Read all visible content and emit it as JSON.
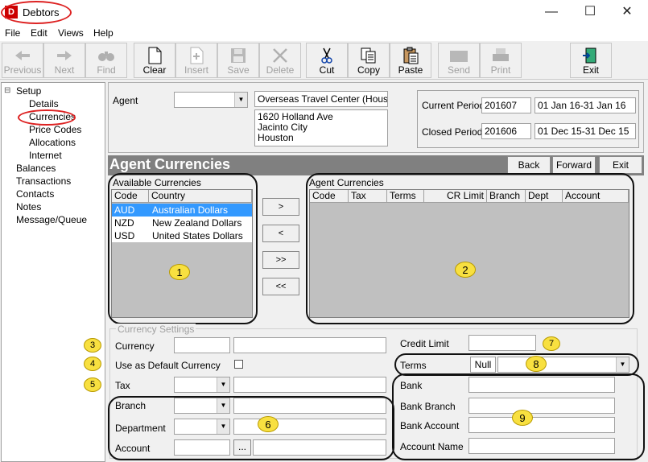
{
  "window": {
    "title": "Debtors",
    "app_icon": "D",
    "min": "—",
    "max": "☐",
    "close": "✕"
  },
  "menu": [
    "File",
    "Edit",
    "Views",
    "Help"
  ],
  "toolbar": {
    "previous": "Previous",
    "next": "Next",
    "find": "Find",
    "clear": "Clear",
    "insert": "Insert",
    "save": "Save",
    "delete": "Delete",
    "cut": "Cut",
    "copy": "Copy",
    "paste": "Paste",
    "send": "Send",
    "print": "Print",
    "exit": "Exit"
  },
  "tree": {
    "setup": "Setup",
    "details": "Details",
    "currencies": "Currencies",
    "price_codes": "Price Codes",
    "allocations": "Allocations",
    "internet": "Internet",
    "balances": "Balances",
    "transactions": "Transactions",
    "contacts": "Contacts",
    "notes": "Notes",
    "message_queue": "Message/Queue"
  },
  "agent": {
    "label": "Agent",
    "name": "Overseas Travel Center (Houston)",
    "address1": "1620 Holland Ave",
    "address2": "Jacinto City",
    "address3": "Houston"
  },
  "period": {
    "current_label": "Current Period",
    "current_code": "201607",
    "current_range": "01 Jan 16-31 Jan 16",
    "closed_label": "Closed Period",
    "closed_code": "201606",
    "closed_range": "01 Dec 15-31 Dec 15"
  },
  "section": {
    "title": "Agent Currencies",
    "back": "Back",
    "forward": "Forward",
    "exit": "Exit"
  },
  "available": {
    "label": "Available Currencies",
    "headers": [
      "Code",
      "Country"
    ],
    "rows": [
      [
        "AUD",
        "Australian Dollars"
      ],
      [
        "NZD",
        "New Zealand Dollars"
      ],
      [
        "USD",
        "United States Dollars"
      ]
    ]
  },
  "move_buttons": [
    ">",
    "<",
    ">>",
    "<<"
  ],
  "agent_currencies": {
    "label": "Agent Currencies",
    "headers": [
      "Code",
      "Tax",
      "Terms",
      "CR Limit",
      "Branch",
      "Dept",
      "Account"
    ]
  },
  "settings": {
    "group_label": "Currency Settings",
    "currency": "Currency",
    "default": "Use as Default Currency",
    "tax": "Tax",
    "branch": "Branch",
    "department": "Department",
    "account": "Account",
    "browse": "...",
    "credit_limit": "Credit Limit",
    "terms": "Terms",
    "null_label": "Null",
    "bank": "Bank",
    "bank_branch": "Bank Branch",
    "bank_account": "Bank Account",
    "account_name": "Account Name"
  },
  "badges": [
    "1",
    "2",
    "3",
    "4",
    "5",
    "6",
    "7",
    "8",
    "9"
  ]
}
